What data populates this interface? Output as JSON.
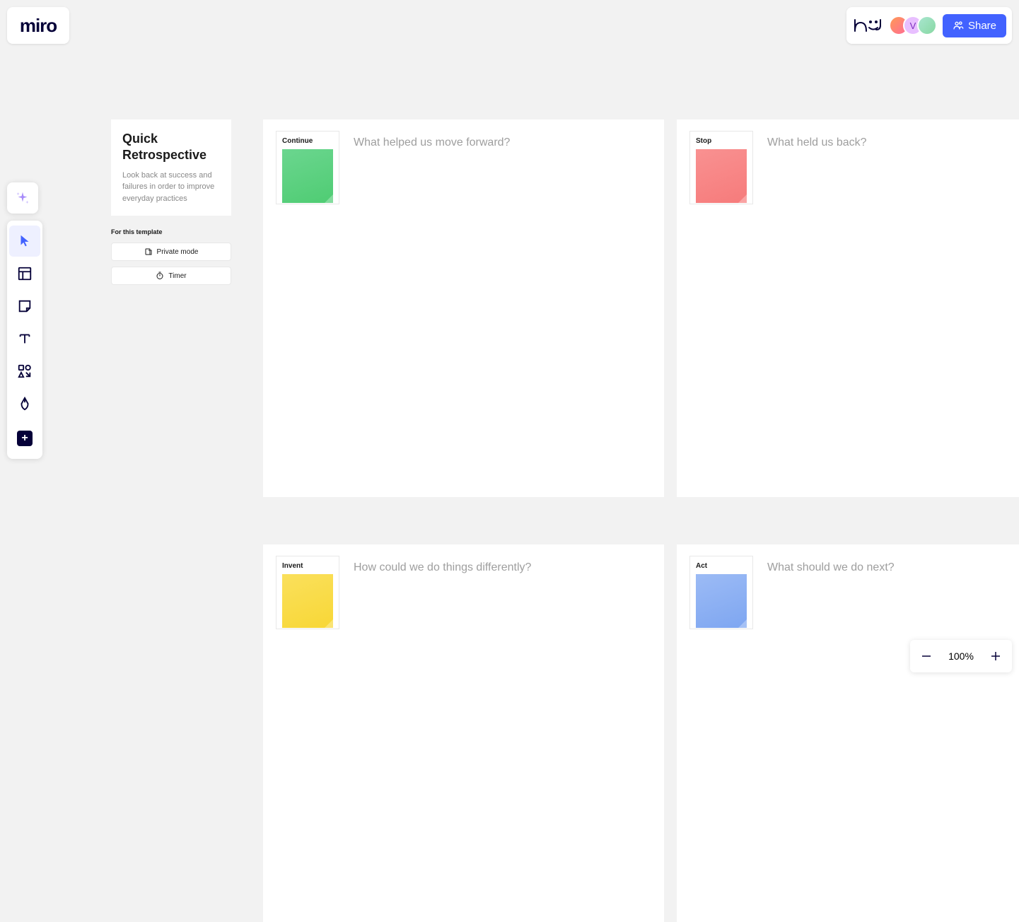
{
  "app": {
    "logo": "miro"
  },
  "topbar": {
    "share_label": "Share",
    "avatar_v": "V"
  },
  "intro": {
    "title": "Quick Retrospective",
    "description": "Look back at success and failures in order to improve everyday practices"
  },
  "template": {
    "label": "For this template",
    "private_mode": "Private mode",
    "timer": "Timer"
  },
  "quadrants": {
    "continue": {
      "label": "Continue",
      "question": "What helped us move forward?"
    },
    "stop": {
      "label": "Stop",
      "question": "What held us back?"
    },
    "invent": {
      "label": "Invent",
      "question": "How could we do things differently?"
    },
    "act": {
      "label": "Act",
      "question": "What should we do next?"
    }
  },
  "zoom": {
    "level": "100%"
  }
}
